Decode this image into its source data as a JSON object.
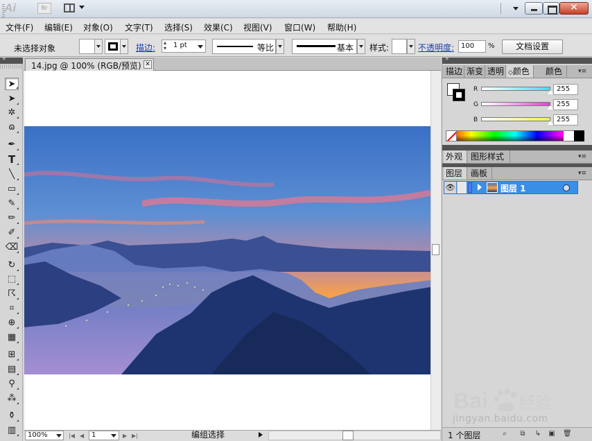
{
  "menu": [
    "文件(F)",
    "编辑(E)",
    "对象(O)",
    "文字(T)",
    "选择(S)",
    "效果(C)",
    "视图(V)",
    "窗口(W)",
    "帮助(H)"
  ],
  "controlbar": {
    "no_selection": "未选择对象",
    "stroke_label": "描边:",
    "stroke_weight": "1 pt",
    "profile_label": "等比",
    "brush_label": "基本",
    "style_label": "样式:",
    "opacity_label": "不透明度:",
    "opacity_value": "100",
    "opacity_unit": "%",
    "doc_setup": "文档设置"
  },
  "document": {
    "tab_title": "14.jpg @ 100% (RGB/预览)",
    "zoom": "100%",
    "artboard": "1",
    "status_tool": "编组选择"
  },
  "panels": {
    "color_tabs": [
      "描边",
      "渐变",
      "透明",
      "颜色",
      "颜色"
    ],
    "color_active_tab": 3,
    "rgb": [
      {
        "channel": "R",
        "value": "255",
        "color": "#4fd8f0"
      },
      {
        "channel": "G",
        "value": "255",
        "color": "#e040d8"
      },
      {
        "channel": "B",
        "value": "255",
        "color": "#f2f24a"
      }
    ],
    "appearance_tabs": [
      "外观",
      "图形样式"
    ],
    "layers_tabs": [
      "图层",
      "画板"
    ],
    "layer_name": "图层 1",
    "layers_count": "1 个图层"
  },
  "watermark": {
    "logo_text": "Bai  经验",
    "url": "jingyan.baidu.com"
  },
  "colors": {
    "selection_blue": "#3a8ee6",
    "link_blue": "#1a3fa8",
    "close_red": "#c4412a"
  }
}
